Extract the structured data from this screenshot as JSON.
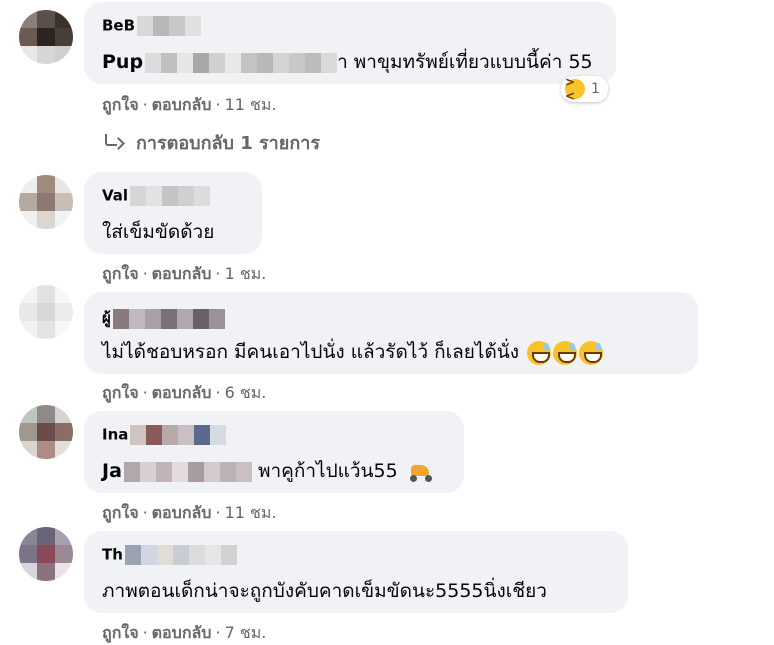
{
  "actions": {
    "like": "ถูกใจ",
    "reply": "ตอบกลับ",
    "separator": "·"
  },
  "comments": [
    {
      "author_prefix": "BeB",
      "text_prefix": "Pup",
      "text_suffix": "า พาขุมทรัพย์เที่ยวแบบนี้ค่า 55",
      "time": "11 ชม.",
      "reaction": {
        "icon": "laughing-emoji-icon",
        "count": "1"
      },
      "replies_link": "การตอบกลับ 1 รายการ"
    },
    {
      "author_prefix": "Val",
      "text": "ใส่เข็มขัดด้วย",
      "time": "1 ชม."
    },
    {
      "author_prefix": "ผู้",
      "text": "ไม่ได้ชอบหรอก มีคนเอาไปนั่ง แล้วรัดไว้ ก็เลยได้นั่ง",
      "emoji": "sweat-smile-emoji-icon",
      "time": "6 ชม."
    },
    {
      "author_prefix": "Ina",
      "text_prefix": "Ja",
      "text_suffix": "พาคูก้าไปแว้น55",
      "emoji": "scooter-emoji-icon",
      "time": "11 ชม."
    },
    {
      "author_prefix": "Th",
      "text": "ภาพตอนเด็กน่าจะถูกบังคับคาดเข็มขัดนะ5555นิ่งเชียว",
      "time": "7 ชม."
    }
  ],
  "colors": {
    "bubble": "#f0f2f5",
    "meta_text": "#65676b",
    "body_text": "#050505"
  }
}
